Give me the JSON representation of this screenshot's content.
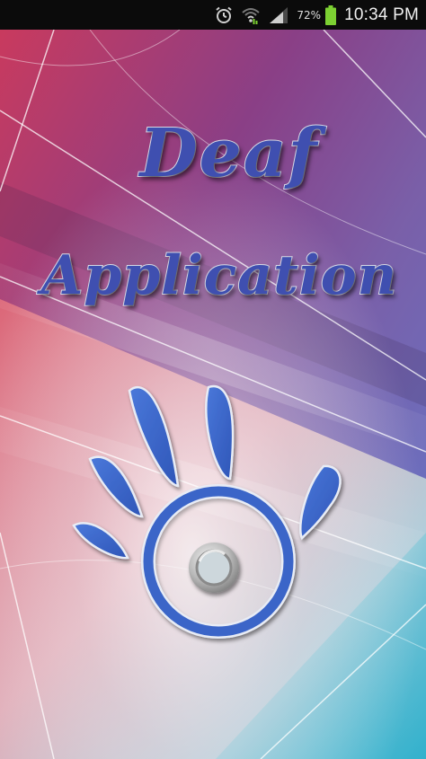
{
  "status_bar": {
    "battery_percent": "72%",
    "time": "10:34 PM",
    "icons": [
      "alarm-icon",
      "wifi-icon",
      "signal-icon",
      "battery-icon"
    ],
    "battery_color": "#7cd032"
  },
  "splash": {
    "title_line_1": "Deaf",
    "title_line_2": "Application",
    "title_color": "#3f4fb0",
    "logo_icon": "hand-sound-logo-icon",
    "logo_color": "#3b65c8"
  }
}
